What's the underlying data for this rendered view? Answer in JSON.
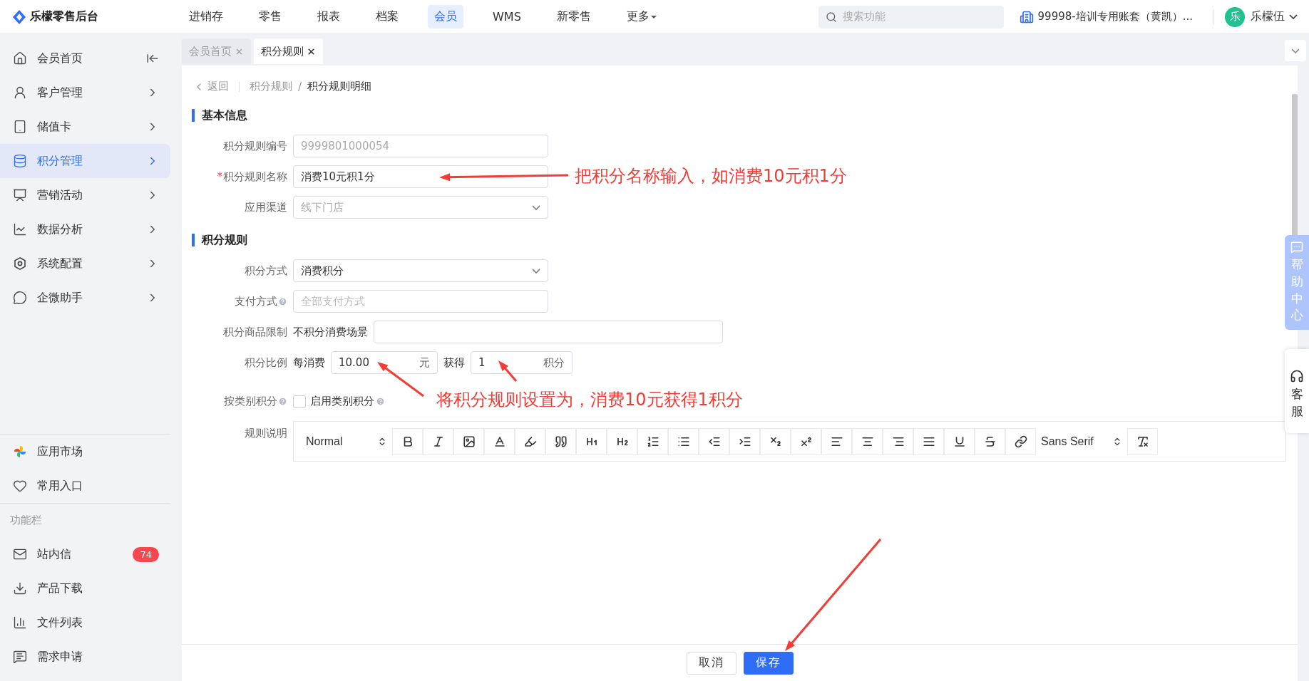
{
  "header": {
    "logo": "乐檬零售后台",
    "nav": [
      {
        "label": "进销存",
        "selected": false
      },
      {
        "label": "零售",
        "selected": false
      },
      {
        "label": "报表",
        "selected": false
      },
      {
        "label": "档案",
        "selected": false
      },
      {
        "label": "会员",
        "selected": true
      },
      {
        "label": "WMS",
        "selected": false
      },
      {
        "label": "新零售",
        "selected": false
      },
      {
        "label": "更多",
        "selected": false,
        "dropdown": true
      }
    ],
    "search": {
      "placeholder": "搜索功能"
    },
    "account": "99998-培训专用账套（黄凯）...",
    "avatar": "乐",
    "user": "乐檬伍"
  },
  "sidebar": {
    "items": [
      {
        "kind": "home",
        "label": "会员首页",
        "selected": false
      },
      {
        "kind": "user",
        "label": "客户管理",
        "selected": false
      },
      {
        "kind": "card",
        "label": "储值卡",
        "selected": false
      },
      {
        "kind": "database",
        "label": "积分管理",
        "selected": true
      },
      {
        "kind": "screen",
        "label": "营销活动",
        "selected": false
      },
      {
        "kind": "chart",
        "label": "数据分析",
        "selected": false
      },
      {
        "kind": "settings",
        "label": "系统配置",
        "selected": false
      },
      {
        "kind": "chat",
        "label": "企微助手",
        "selected": false
      }
    ],
    "extras": [
      {
        "kind": "apps",
        "label": "应用市场"
      },
      {
        "kind": "heart",
        "label": "常用入口"
      }
    ],
    "section_title": "功能栏",
    "tools": [
      {
        "kind": "mail",
        "label": "站内信",
        "badge": "74"
      },
      {
        "kind": "download",
        "label": "产品下载"
      },
      {
        "kind": "bars",
        "label": "文件列表"
      },
      {
        "kind": "feedback",
        "label": "需求申请"
      }
    ]
  },
  "tabs": [
    {
      "label": "会员首页",
      "selected": false
    },
    {
      "label": "积分规则",
      "selected": true
    }
  ],
  "breadcrumb": {
    "back": "返回",
    "separator": "/",
    "path": [
      "积分规则",
      "积分规则明细"
    ]
  },
  "sections": [
    {
      "title": "基本信息",
      "fields": [
        {
          "kind": "input",
          "label": "积分规则编号",
          "value": "9999801000054",
          "disabled": true
        },
        {
          "kind": "input",
          "label": "积分规则名称",
          "value": "消费10元积1分",
          "disabled": false,
          "required_mark": "*"
        },
        {
          "kind": "select",
          "label": "应用渠道",
          "value": "线下门店",
          "disabled": true
        }
      ]
    },
    {
      "title": "积分规则",
      "fields": [
        {
          "kind": "select",
          "label": "积分方式",
          "value": "消费积分",
          "disabled": false
        },
        {
          "kind": "input",
          "label": "支付方式",
          "placeholder": "全部支付方式",
          "help": true
        },
        {
          "kind": "scene",
          "label": "积分商品限制",
          "text": "不积分消费场景"
        },
        {
          "kind": "ratio",
          "label": "积分比例",
          "prefix": "每消费",
          "amount": "10.00",
          "amount_unit": "元",
          "middle": "获得",
          "points": "1",
          "points_unit": "积分"
        },
        {
          "kind": "checkbox",
          "label": "按类别积分",
          "text": "启用类别积分",
          "checked": false,
          "help": true
        },
        {
          "kind": "editor",
          "label": "规则说明"
        }
      ]
    }
  ],
  "toolbar": [
    {
      "kind": "picker",
      "label": "Normal"
    },
    {
      "kind": "bold"
    },
    {
      "kind": "italic"
    },
    {
      "kind": "image"
    },
    {
      "kind": "color"
    },
    {
      "kind": "background"
    },
    {
      "kind": "quote"
    },
    {
      "kind": "h1"
    },
    {
      "kind": "h2"
    },
    {
      "kind": "ordered"
    },
    {
      "kind": "bullet"
    },
    {
      "kind": "outdent"
    },
    {
      "kind": "indent"
    },
    {
      "kind": "sub"
    },
    {
      "kind": "sup"
    },
    {
      "kind": "left"
    },
    {
      "kind": "center"
    },
    {
      "kind": "right"
    },
    {
      "kind": "justify"
    },
    {
      "kind": "underline"
    },
    {
      "kind": "strike"
    },
    {
      "kind": "link"
    },
    {
      "kind": "picker",
      "label": "Sans Serif"
    },
    {
      "kind": "clean"
    }
  ],
  "footer": {
    "cancel": "取消",
    "save": "保存"
  },
  "side_tabs": [
    {
      "kind": "help",
      "label": "帮助中心"
    },
    {
      "kind": "service",
      "label": "客服"
    }
  ],
  "annotations": [
    {
      "text": "把积分名称输入，如消费10元积1分"
    },
    {
      "text": "将积分规则设置为，消费10元获得1积分"
    }
  ]
}
